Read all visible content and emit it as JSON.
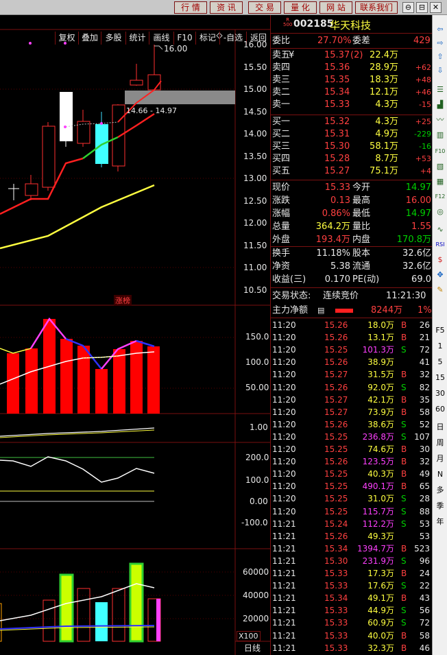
{
  "topmenu": [
    "行 情",
    "资 讯",
    "交 易",
    "量 化",
    "网 站",
    "联系我们"
  ],
  "winbtns": [
    "⊖",
    "⊟",
    "✕"
  ],
  "toolbar": [
    "复权",
    "叠加",
    "多股",
    "统计",
    "画线",
    "F10",
    "标记",
    "-自选",
    "返回"
  ],
  "price_axis": [
    "16.00",
    "15.50",
    "15.00",
    "14.50",
    "14.00",
    "13.50",
    "13.00",
    "12.50",
    "12.00",
    "11.50",
    "11.00",
    "10.50"
  ],
  "high_label": "16.00",
  "range_label": "14.66 - 14.97",
  "zhangbang": "涨榜",
  "ind1_axis": [
    "150.0",
    "100.0",
    "50.00"
  ],
  "ind2_axis": [
    "1.00"
  ],
  "ind3_axis": [
    "200.0",
    "100.0",
    "0.00",
    "-100.0"
  ],
  "vol_axis": [
    "60000",
    "40000",
    "20000"
  ],
  "vol_unit": "X100",
  "period_label": "日线",
  "stock": {
    "badge_top": "R",
    "badge_bottom": "500",
    "code": "002185",
    "name": "华天科技"
  },
  "weibi": {
    "l1": "委比",
    "v1": "27.70%",
    "l2": "委差",
    "v2": "429"
  },
  "asks": [
    {
      "label": "卖五",
      "mark": "¥",
      "price": "15.37",
      "count": "(2)",
      "vol": "22.4万",
      "chg": ""
    },
    {
      "label": "卖四",
      "mark": "",
      "price": "15.36",
      "count": "",
      "vol": "28.9万",
      "chg": "+62"
    },
    {
      "label": "卖三",
      "mark": "",
      "price": "15.35",
      "count": "",
      "vol": "18.3万",
      "chg": "+48"
    },
    {
      "label": "卖二",
      "mark": "",
      "price": "15.34",
      "count": "",
      "vol": "12.1万",
      "chg": "+46"
    },
    {
      "label": "卖一",
      "mark": "",
      "price": "15.33",
      "count": "",
      "vol": "4.3万",
      "chg": "-15"
    }
  ],
  "bids": [
    {
      "label": "买一",
      "price": "15.32",
      "vol": "4.3万",
      "chg": "+25"
    },
    {
      "label": "买二",
      "price": "15.31",
      "vol": "4.9万",
      "chg": "-229"
    },
    {
      "label": "买三",
      "price": "15.30",
      "vol": "58.1万",
      "chg": "-16"
    },
    {
      "label": "买四",
      "price": "15.28",
      "vol": "8.7万",
      "chg": "+53"
    },
    {
      "label": "买五",
      "price": "15.27",
      "vol": "75.1万",
      "chg": "+4"
    }
  ],
  "stats": [
    {
      "l1": "现价",
      "v1": "15.33",
      "l2": "今开",
      "v2": "14.97"
    },
    {
      "l1": "涨跌",
      "v1": "0.13",
      "l2": "最高",
      "v2": "16.00"
    },
    {
      "l1": "涨幅",
      "v1": "0.86%",
      "l2": "最低",
      "v2": "14.97"
    },
    {
      "l1": "总量",
      "v1": "364.2万",
      "l2": "量比",
      "v2": "1.55"
    },
    {
      "l1": "外盘",
      "v1": "193.4万",
      "l2": "内盘",
      "v2": "170.8万"
    }
  ],
  "fund": [
    {
      "l1": "换手",
      "v1": "11.18%",
      "l2": "股本",
      "v2": "32.6亿"
    },
    {
      "l1": "净资",
      "v1": "5.38",
      "l2": "流通",
      "v2": "32.6亿"
    },
    {
      "l1": "收益(三)",
      "v1": "0.170",
      "l2": "PE(动)",
      "v2": "69.0"
    }
  ],
  "status": {
    "label": "交易状态:",
    "value": "连续竞价",
    "time": "11:21:30"
  },
  "mainflow": {
    "label": "主力净额",
    "value": "8244万",
    "pct": "1%"
  },
  "ticks": [
    {
      "t": "11:20",
      "p": "15.26",
      "v": "18.0万",
      "d": "B",
      "n": "26"
    },
    {
      "t": "11:20",
      "p": "15.26",
      "v": "13.1万",
      "d": "B",
      "n": "21"
    },
    {
      "t": "11:20",
      "p": "15.25",
      "v": "101.3万",
      "d": "S",
      "n": "72"
    },
    {
      "t": "11:20",
      "p": "15.26",
      "v": "38.9万",
      "d": "",
      "n": "41"
    },
    {
      "t": "11:20",
      "p": "15.27",
      "v": "31.5万",
      "d": "B",
      "n": "32"
    },
    {
      "t": "11:20",
      "p": "15.26",
      "v": "92.0万",
      "d": "S",
      "n": "82"
    },
    {
      "t": "11:20",
      "p": "15.27",
      "v": "42.1万",
      "d": "B",
      "n": "35"
    },
    {
      "t": "11:20",
      "p": "15.27",
      "v": "73.9万",
      "d": "B",
      "n": "58"
    },
    {
      "t": "11:20",
      "p": "15.26",
      "v": "38.6万",
      "d": "S",
      "n": "52"
    },
    {
      "t": "11:20",
      "p": "15.25",
      "v": "236.8万",
      "d": "S",
      "n": "107"
    },
    {
      "t": "11:20",
      "p": "15.25",
      "v": "74.6万",
      "d": "B",
      "n": "30"
    },
    {
      "t": "11:20",
      "p": "15.26",
      "v": "123.5万",
      "d": "B",
      "n": "32"
    },
    {
      "t": "11:20",
      "p": "15.25",
      "v": "40.3万",
      "d": "B",
      "n": "49"
    },
    {
      "t": "11:20",
      "p": "15.25",
      "v": "490.1万",
      "d": "B",
      "n": "65"
    },
    {
      "t": "11:20",
      "p": "15.25",
      "v": "31.0万",
      "d": "S",
      "n": "28"
    },
    {
      "t": "11:20",
      "p": "15.25",
      "v": "115.7万",
      "d": "S",
      "n": "88"
    },
    {
      "t": "11:21",
      "p": "15.24",
      "v": "112.2万",
      "d": "S",
      "n": "53"
    },
    {
      "t": "11:21",
      "p": "15.26",
      "v": "49.3万",
      "d": "",
      "n": "53"
    },
    {
      "t": "11:21",
      "p": "15.34",
      "v": "1394.7万",
      "d": "B",
      "n": "523"
    },
    {
      "t": "11:21",
      "p": "15.30",
      "v": "231.9万",
      "d": "S",
      "n": "96"
    },
    {
      "t": "11:21",
      "p": "15.33",
      "v": "17.3万",
      "d": "B",
      "n": "24"
    },
    {
      "t": "11:21",
      "p": "15.33",
      "v": "17.6万",
      "d": "S",
      "n": "22"
    },
    {
      "t": "11:21",
      "p": "15.34",
      "v": "49.1万",
      "d": "B",
      "n": "43"
    },
    {
      "t": "11:21",
      "p": "15.33",
      "v": "44.9万",
      "d": "S",
      "n": "56"
    },
    {
      "t": "11:21",
      "p": "15.33",
      "v": "60.9万",
      "d": "S",
      "n": "72"
    },
    {
      "t": "11:21",
      "p": "15.33",
      "v": "40.0万",
      "d": "B",
      "n": "58"
    },
    {
      "t": "11:21",
      "p": "15.33",
      "v": "32.3万",
      "d": "B",
      "n": "46"
    }
  ],
  "sidebar_text": [
    "F5",
    "1",
    "5",
    "15",
    "30",
    "60",
    "日",
    "周",
    "月",
    "N",
    "多",
    "季",
    "年"
  ],
  "sidebar_icons": [
    "arrow-left",
    "arrow-right",
    "arrow-up",
    "arrow-down",
    "list",
    "chart",
    "line",
    "bar",
    "f10",
    "fill",
    "fund",
    "f12",
    "ring",
    "wave",
    "rsi",
    "dollar",
    "move",
    "pen"
  ]
}
